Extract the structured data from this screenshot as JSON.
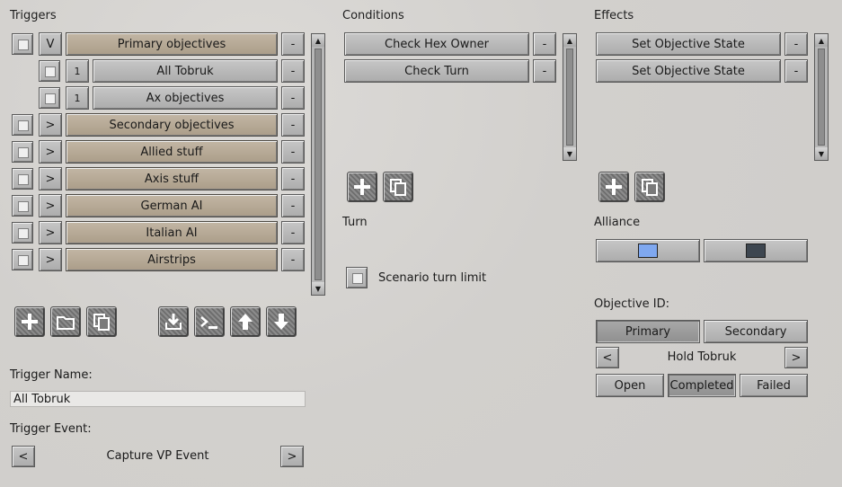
{
  "triggers": {
    "title": "Triggers",
    "items": [
      {
        "label": "Primary objectives",
        "toggle": "V",
        "indent": 0,
        "style": "tan"
      },
      {
        "label": "All Tobruk",
        "toggle": "1",
        "indent": 1,
        "style": "gray"
      },
      {
        "label": "Ax objectives",
        "toggle": "1",
        "indent": 1,
        "style": "gray"
      },
      {
        "label": "Secondary objectives",
        "toggle": ">",
        "indent": 0,
        "style": "tan"
      },
      {
        "label": "Allied stuff",
        "toggle": ">",
        "indent": 0,
        "style": "tan"
      },
      {
        "label": "Axis stuff",
        "toggle": ">",
        "indent": 0,
        "style": "tan"
      },
      {
        "label": "German AI",
        "toggle": ">",
        "indent": 0,
        "style": "tan"
      },
      {
        "label": "Italian AI",
        "toggle": ">",
        "indent": 0,
        "style": "tan"
      },
      {
        "label": "Airstrips",
        "toggle": ">",
        "indent": 0,
        "style": "tan"
      }
    ],
    "remove_label": "-",
    "name_label": "Trigger Name:",
    "name_value": "All Tobruk",
    "event_label": "Trigger Event:",
    "event_value": "Capture VP Event",
    "prev": "<",
    "next": ">"
  },
  "conditions": {
    "title": "Conditions",
    "items": [
      "Check Hex Owner",
      "Check Turn"
    ],
    "remove_label": "-"
  },
  "turn": {
    "title": "Turn",
    "checkbox_label": "Scenario turn limit"
  },
  "effects": {
    "title": "Effects",
    "items": [
      "Set Objective State",
      "Set Objective State"
    ],
    "remove_label": "-"
  },
  "alliance": {
    "title": "Alliance",
    "colors": [
      "#7fa8f0",
      "#3d4650"
    ]
  },
  "objective": {
    "title": "Objective ID:",
    "tabs": [
      "Primary",
      "Secondary"
    ],
    "selected_tab": "Primary",
    "value": "Hold Tobruk",
    "prev": "<",
    "next": ">",
    "states": [
      "Open",
      "Completed",
      "Failed"
    ],
    "selected_state": "Completed"
  },
  "icons": {
    "add": "plus-icon",
    "folder": "folder-icon",
    "copy": "copy-icon",
    "import": "import-icon",
    "console": "console-icon",
    "up": "arrow-up-icon",
    "down": "arrow-down-icon"
  }
}
